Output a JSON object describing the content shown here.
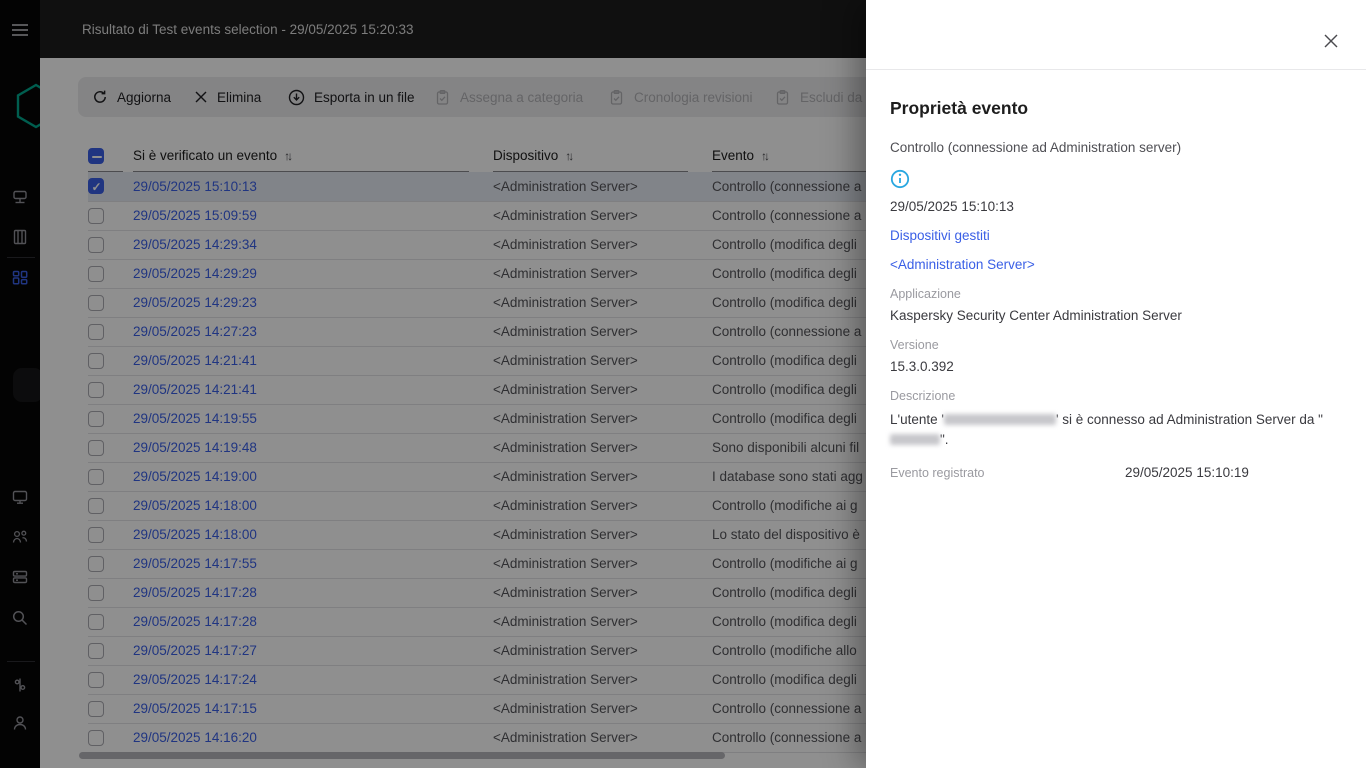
{
  "colors": {
    "accent": "#3A5FE6",
    "info": "#29A7E0",
    "logo": "#00A88E"
  },
  "header": {
    "title": "Risultato di Test events selection - 29/05/2025 15:20:33"
  },
  "sidebar": {
    "icons": [
      "hamburger-menu-icon",
      "kaspersky-logo",
      "network-icon",
      "book-icon",
      "dashboard-grid-icon",
      "monitor-icon",
      "users-icon",
      "server-stack-icon",
      "search-icon",
      "sliders-icon",
      "user-profile-icon"
    ]
  },
  "toolbar": {
    "buttons": [
      {
        "label": "Aggiorna",
        "icon": "refresh-icon",
        "enabled": true
      },
      {
        "label": "Elimina",
        "icon": "x-icon",
        "enabled": true
      },
      {
        "label": "Esporta in un file",
        "icon": "download-circle-icon",
        "enabled": true
      },
      {
        "label": "Assegna a categoria",
        "icon": "clipboard-check-icon",
        "enabled": false
      },
      {
        "label": "Cronologia revisioni",
        "icon": "clipboard-check-icon",
        "enabled": false
      },
      {
        "label": "Escludi da C",
        "icon": "clipboard-check-icon",
        "enabled": false
      }
    ]
  },
  "table": {
    "select_all_state": "indeterminate",
    "sort_glyph": "↑↓",
    "columns": [
      {
        "label": "Si è verificato un evento"
      },
      {
        "label": "Dispositivo"
      },
      {
        "label": "Evento"
      }
    ],
    "rows": [
      {
        "checked": true,
        "date": "29/05/2025 15:10:13",
        "device": "<Administration Server>",
        "event": "Controllo (connessione a"
      },
      {
        "checked": false,
        "date": "29/05/2025 15:09:59",
        "device": "<Administration Server>",
        "event": "Controllo (connessione a"
      },
      {
        "checked": false,
        "date": "29/05/2025 14:29:34",
        "device": "<Administration Server>",
        "event": "Controllo (modifica degli"
      },
      {
        "checked": false,
        "date": "29/05/2025 14:29:29",
        "device": "<Administration Server>",
        "event": "Controllo (modifica degli"
      },
      {
        "checked": false,
        "date": "29/05/2025 14:29:23",
        "device": "<Administration Server>",
        "event": "Controllo (modifica degli"
      },
      {
        "checked": false,
        "date": "29/05/2025 14:27:23",
        "device": "<Administration Server>",
        "event": "Controllo (connessione a"
      },
      {
        "checked": false,
        "date": "29/05/2025 14:21:41",
        "device": "<Administration Server>",
        "event": "Controllo (modifica degli"
      },
      {
        "checked": false,
        "date": "29/05/2025 14:21:41",
        "device": "<Administration Server>",
        "event": "Controllo (modifica degli"
      },
      {
        "checked": false,
        "date": "29/05/2025 14:19:55",
        "device": "<Administration Server>",
        "event": "Controllo (modifica degli"
      },
      {
        "checked": false,
        "date": "29/05/2025 14:19:48",
        "device": "<Administration Server>",
        "event": "Sono disponibili alcuni fil"
      },
      {
        "checked": false,
        "date": "29/05/2025 14:19:00",
        "device": "<Administration Server>",
        "event": "I database sono stati agg"
      },
      {
        "checked": false,
        "date": "29/05/2025 14:18:00",
        "device": "<Administration Server>",
        "event": "Controllo (modifiche ai g"
      },
      {
        "checked": false,
        "date": "29/05/2025 14:18:00",
        "device": "<Administration Server>",
        "event": "Lo stato del dispositivo è"
      },
      {
        "checked": false,
        "date": "29/05/2025 14:17:55",
        "device": "<Administration Server>",
        "event": "Controllo (modifiche ai g"
      },
      {
        "checked": false,
        "date": "29/05/2025 14:17:28",
        "device": "<Administration Server>",
        "event": "Controllo (modifica degli"
      },
      {
        "checked": false,
        "date": "29/05/2025 14:17:28",
        "device": "<Administration Server>",
        "event": "Controllo (modifica degli"
      },
      {
        "checked": false,
        "date": "29/05/2025 14:17:27",
        "device": "<Administration Server>",
        "event": "Controllo (modifiche allo"
      },
      {
        "checked": false,
        "date": "29/05/2025 14:17:24",
        "device": "<Administration Server>",
        "event": "Controllo (modifica degli"
      },
      {
        "checked": false,
        "date": "29/05/2025 14:17:15",
        "device": "<Administration Server>",
        "event": "Controllo (connessione a"
      },
      {
        "checked": false,
        "date": "29/05/2025 14:16:20",
        "device": "<Administration Server>",
        "event": "Controllo (connessione a"
      }
    ]
  },
  "panel": {
    "title": "Proprietà evento",
    "event_type": "Controllo (connessione ad Administration server)",
    "severity_icon": "info-icon",
    "timestamp": "29/05/2025 15:10:13",
    "links": [
      "Dispositivi gestiti",
      "<Administration Server>"
    ],
    "fields": [
      {
        "label": "Applicazione",
        "value": "Kaspersky Security Center Administration Server"
      },
      {
        "label": "Versione",
        "value": "15.3.0.392"
      }
    ],
    "description": {
      "label": "Descrizione",
      "prefix": "L'utente '",
      "middle": "' si è connesso ad Administration Server da \"",
      "suffix": "\"."
    },
    "registered": {
      "label": "Evento registrato",
      "value": "29/05/2025 15:10:19"
    }
  }
}
